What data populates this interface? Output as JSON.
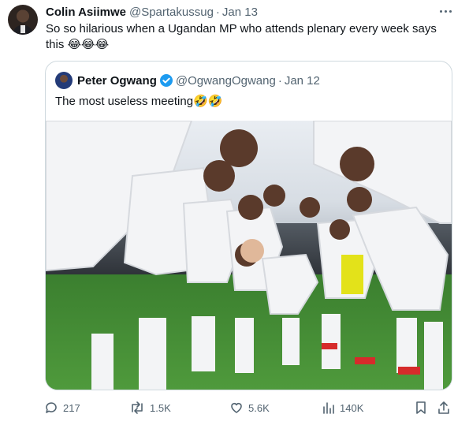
{
  "tweet": {
    "author_name": "Colin Asiimwe",
    "author_handle": "@Spartakussug",
    "separator": "·",
    "date": "Jan 13",
    "text": "So so hilarious when a Ugandan MP who attends plenary every week says this 😂😂😂"
  },
  "quoted": {
    "author_name": "Peter Ogwang",
    "author_handle": "@OgwangOgwang",
    "separator": "·",
    "date": "Jan 12",
    "text": "The most useless meeting🤣🤣",
    "image_description_icon": "photo-football-team-huddle"
  },
  "stats": {
    "replies": "217",
    "retweets": "1.5K",
    "likes": "5.6K",
    "views": "140K"
  },
  "icons": {
    "more": "more-icon",
    "verified": "verified-badge-icon",
    "reply": "reply-icon",
    "retweet": "retweet-icon",
    "like": "heart-icon",
    "views": "views-icon",
    "bookmark": "bookmark-icon",
    "share": "share-icon"
  },
  "colors": {
    "text": "#0f1419",
    "secondary": "#536471",
    "border": "#cfd9de",
    "verified": "#1d9bf0"
  }
}
